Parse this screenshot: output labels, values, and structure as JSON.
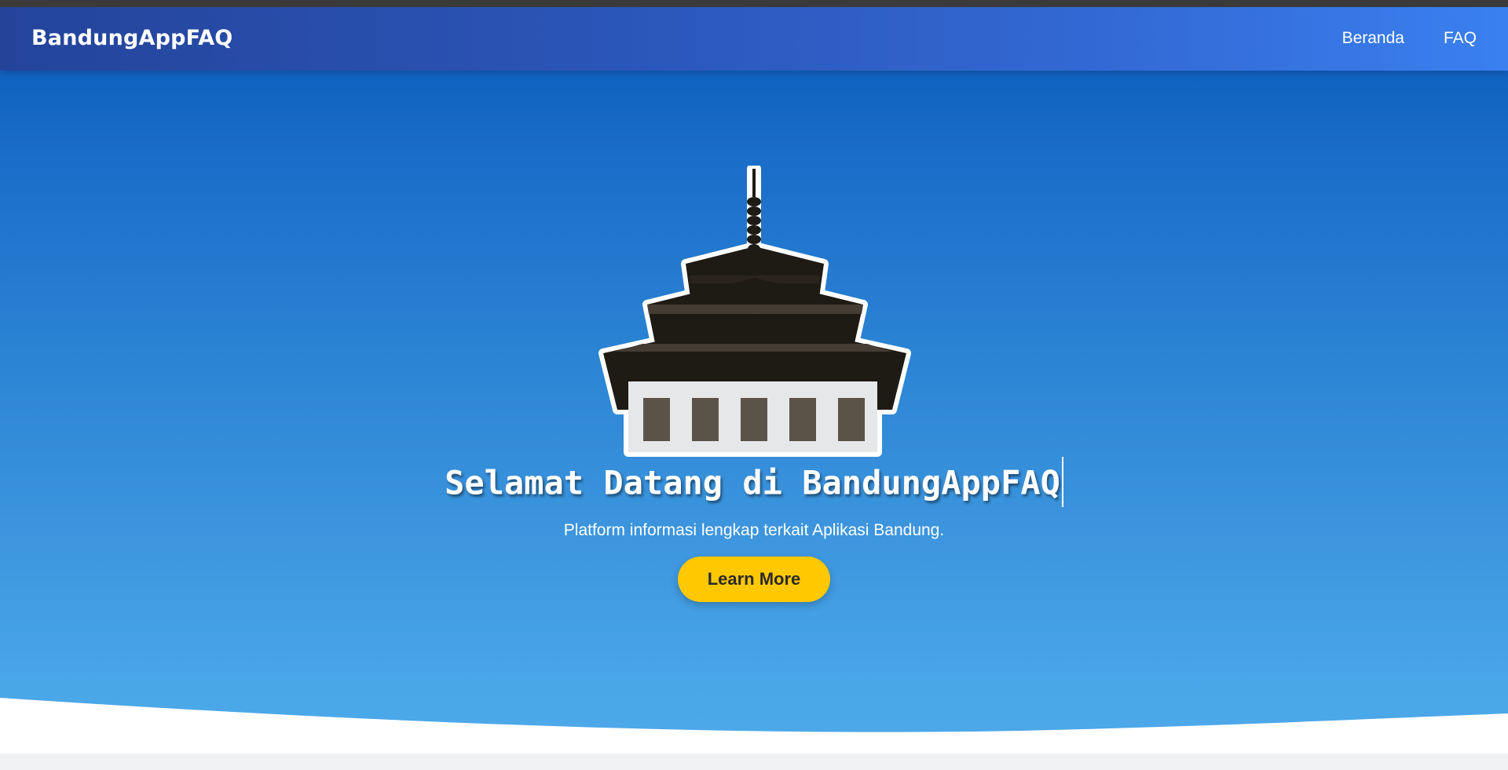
{
  "navbar": {
    "brand": "BandungAppFAQ",
    "links": [
      {
        "label": "Beranda"
      },
      {
        "label": "FAQ"
      }
    ]
  },
  "hero": {
    "title": "Selamat Datang di BandungAppFAQ",
    "subtitle": "Platform informasi lengkap terkait Aplikasi Bandung.",
    "cta_label": "Learn More",
    "logo_icon": "gedung-sate-icon"
  },
  "colors": {
    "nav_gradient_start": "#24449a",
    "nav_gradient_end": "#3a80ef",
    "hero_top": "#0a5abb",
    "hero_bottom": "#4ea9ea",
    "cta_background": "#ffc800",
    "cta_text": "#2a2a2a",
    "logo_roof": "#1e1a14",
    "logo_body": "#e6e7e9",
    "logo_window": "#5c5348"
  }
}
